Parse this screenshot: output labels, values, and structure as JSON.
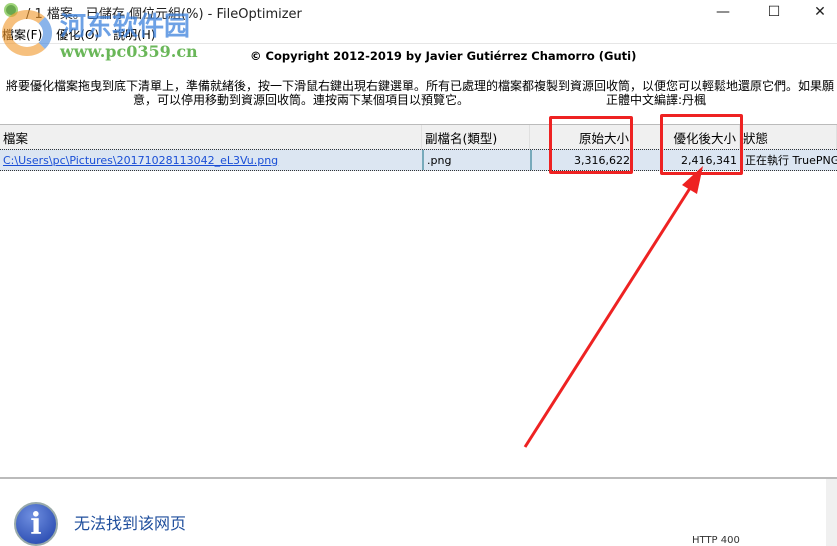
{
  "window": {
    "title": "/ 1 檔案。已儲存 個位元組(%) - FileOptimizer",
    "minimize": "—",
    "maximize": "☐",
    "close": "✕"
  },
  "menu": [
    "檔案(F)",
    "優化(O)",
    "說明(H)"
  ],
  "copyright": "© Copyright 2012-2019 by Javier Gutiérrez Chamorro (Guti)",
  "instructions": {
    "line1": "將要優化檔案拖曳到底下清單上，準備就緒後，按一下滑鼠右鍵出現右鍵選單。所有已處理的檔案都複製到資源回收筒，以便您可以輕鬆地還原它們。如果願",
    "line2": "意，可以停用移動到資源回收筒。連按兩下某個項目以預覽它。",
    "translator": "正體中文編譯:丹楓"
  },
  "table": {
    "columns": [
      "檔案",
      "副檔名(類型)",
      "原始大小",
      "優化後大小",
      "狀態"
    ],
    "rows": [
      {
        "file": "C:\\Users\\pc\\Pictures\\20171028113042_eL3Vu.png",
        "ext": ".png",
        "original": "3,316,622",
        "optimized": "2,416,341",
        "status": "正在執行 TruePNG"
      }
    ]
  },
  "browser_panel": {
    "error_title": "无法找到该网页",
    "http_code": "HTTP 400"
  },
  "watermark": {
    "name": "河东软件园",
    "url": "www.pc0359.cn"
  },
  "annotation_color": "#ee2222"
}
